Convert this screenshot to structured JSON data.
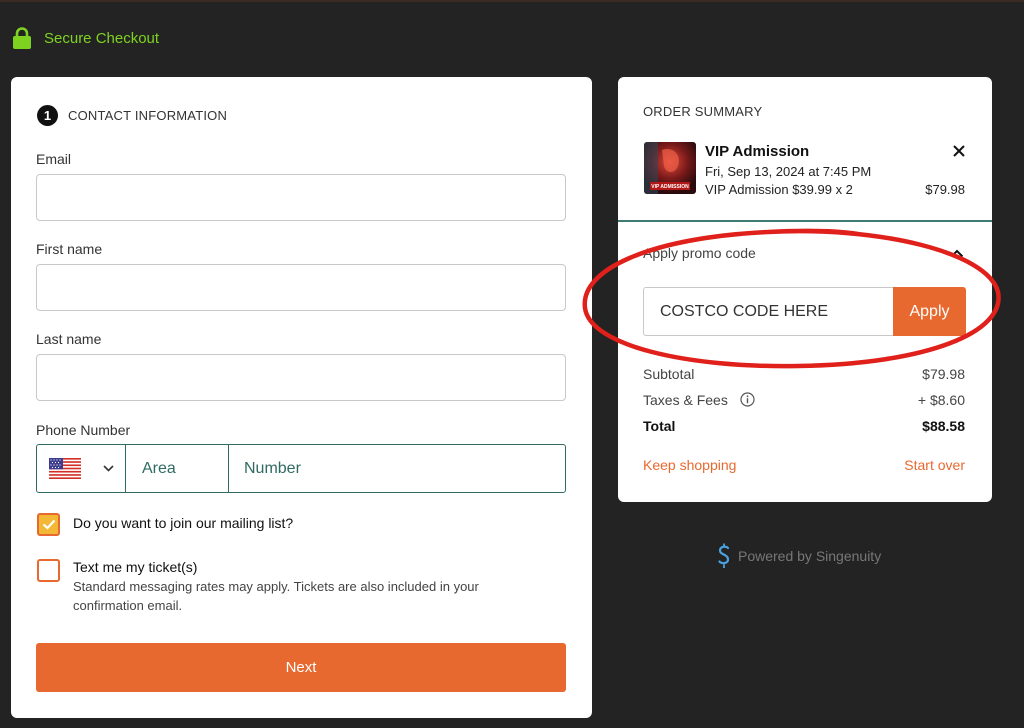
{
  "header": {
    "secure_label": "Secure Checkout"
  },
  "contact": {
    "step": "1",
    "title": "CONTACT INFORMATION",
    "email_label": "Email",
    "first_name_label": "First name",
    "last_name_label": "Last name",
    "phone_label": "Phone Number",
    "area_placeholder": "Area",
    "number_placeholder": "Number",
    "country": "US",
    "mailing_label": "Do you want to join our mailing list?",
    "mailing_checked": true,
    "text_label": "Text me my ticket(s)",
    "text_sub": "Standard messaging rates may apply. Tickets are also included in your confirmation email.",
    "text_checked": false,
    "next_label": "Next"
  },
  "summary": {
    "title": "ORDER SUMMARY",
    "item": {
      "name": "VIP Admission",
      "date": "Fri, Sep 13, 2024 at 7:45 PM",
      "detail": "VIP Admission $39.99 x 2",
      "price": "$79.98",
      "thumb_label": "VIP ADMISSION"
    },
    "promo_label": "Apply promo code",
    "promo_value": "COSTCO CODE HERE",
    "apply_label": "Apply",
    "subtotal_label": "Subtotal",
    "subtotal": "$79.98",
    "taxes_label": "Taxes & Fees",
    "taxes": "+ $8.60",
    "total_label": "Total",
    "total": "$88.58",
    "keep_shopping": "Keep shopping",
    "start_over": "Start over"
  },
  "footer": {
    "powered": "Powered by Singenuity"
  },
  "colors": {
    "accent": "#e8692f",
    "teal": "#2f6b62",
    "green": "#7ed321",
    "background": "#232323",
    "annotation": "#e0201a"
  }
}
